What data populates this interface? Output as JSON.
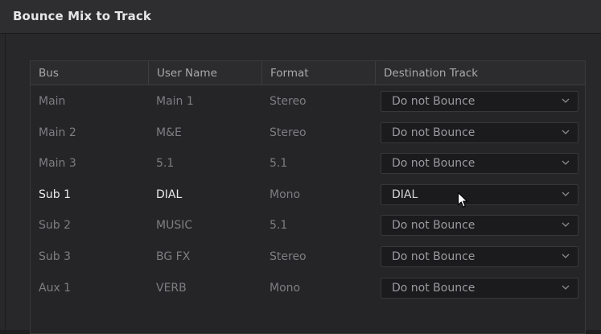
{
  "window": {
    "title": "Bounce Mix to Track"
  },
  "table": {
    "columns": [
      "Bus",
      "User Name",
      "Format",
      "Destination Track"
    ],
    "rows": [
      {
        "bus": "Main",
        "user_name": "Main 1",
        "format": "Stereo",
        "destination": "Do not Bounce",
        "active": false
      },
      {
        "bus": "Main 2",
        "user_name": "M&E",
        "format": "Stereo",
        "destination": "Do not Bounce",
        "active": false
      },
      {
        "bus": "Main 3",
        "user_name": "5.1",
        "format": "5.1",
        "destination": "Do not Bounce",
        "active": false
      },
      {
        "bus": "Sub 1",
        "user_name": "DIAL",
        "format": "Mono",
        "destination": "DIAL",
        "active": true
      },
      {
        "bus": "Sub 2",
        "user_name": "MUSIC",
        "format": "5.1",
        "destination": "Do not Bounce",
        "active": false
      },
      {
        "bus": "Sub 3",
        "user_name": "BG FX",
        "format": "Stereo",
        "destination": "Do not Bounce",
        "active": false
      },
      {
        "bus": "Aux 1",
        "user_name": "VERB",
        "format": "Mono",
        "destination": "Do not Bounce",
        "active": false
      }
    ]
  },
  "icons": {
    "dropdown": "chevron-down-icon",
    "pointer": "mouse-pointer-icon"
  },
  "colors": {
    "background": "#28282a",
    "text_dim": "#7e7e82",
    "text_active": "#eaeaea"
  }
}
